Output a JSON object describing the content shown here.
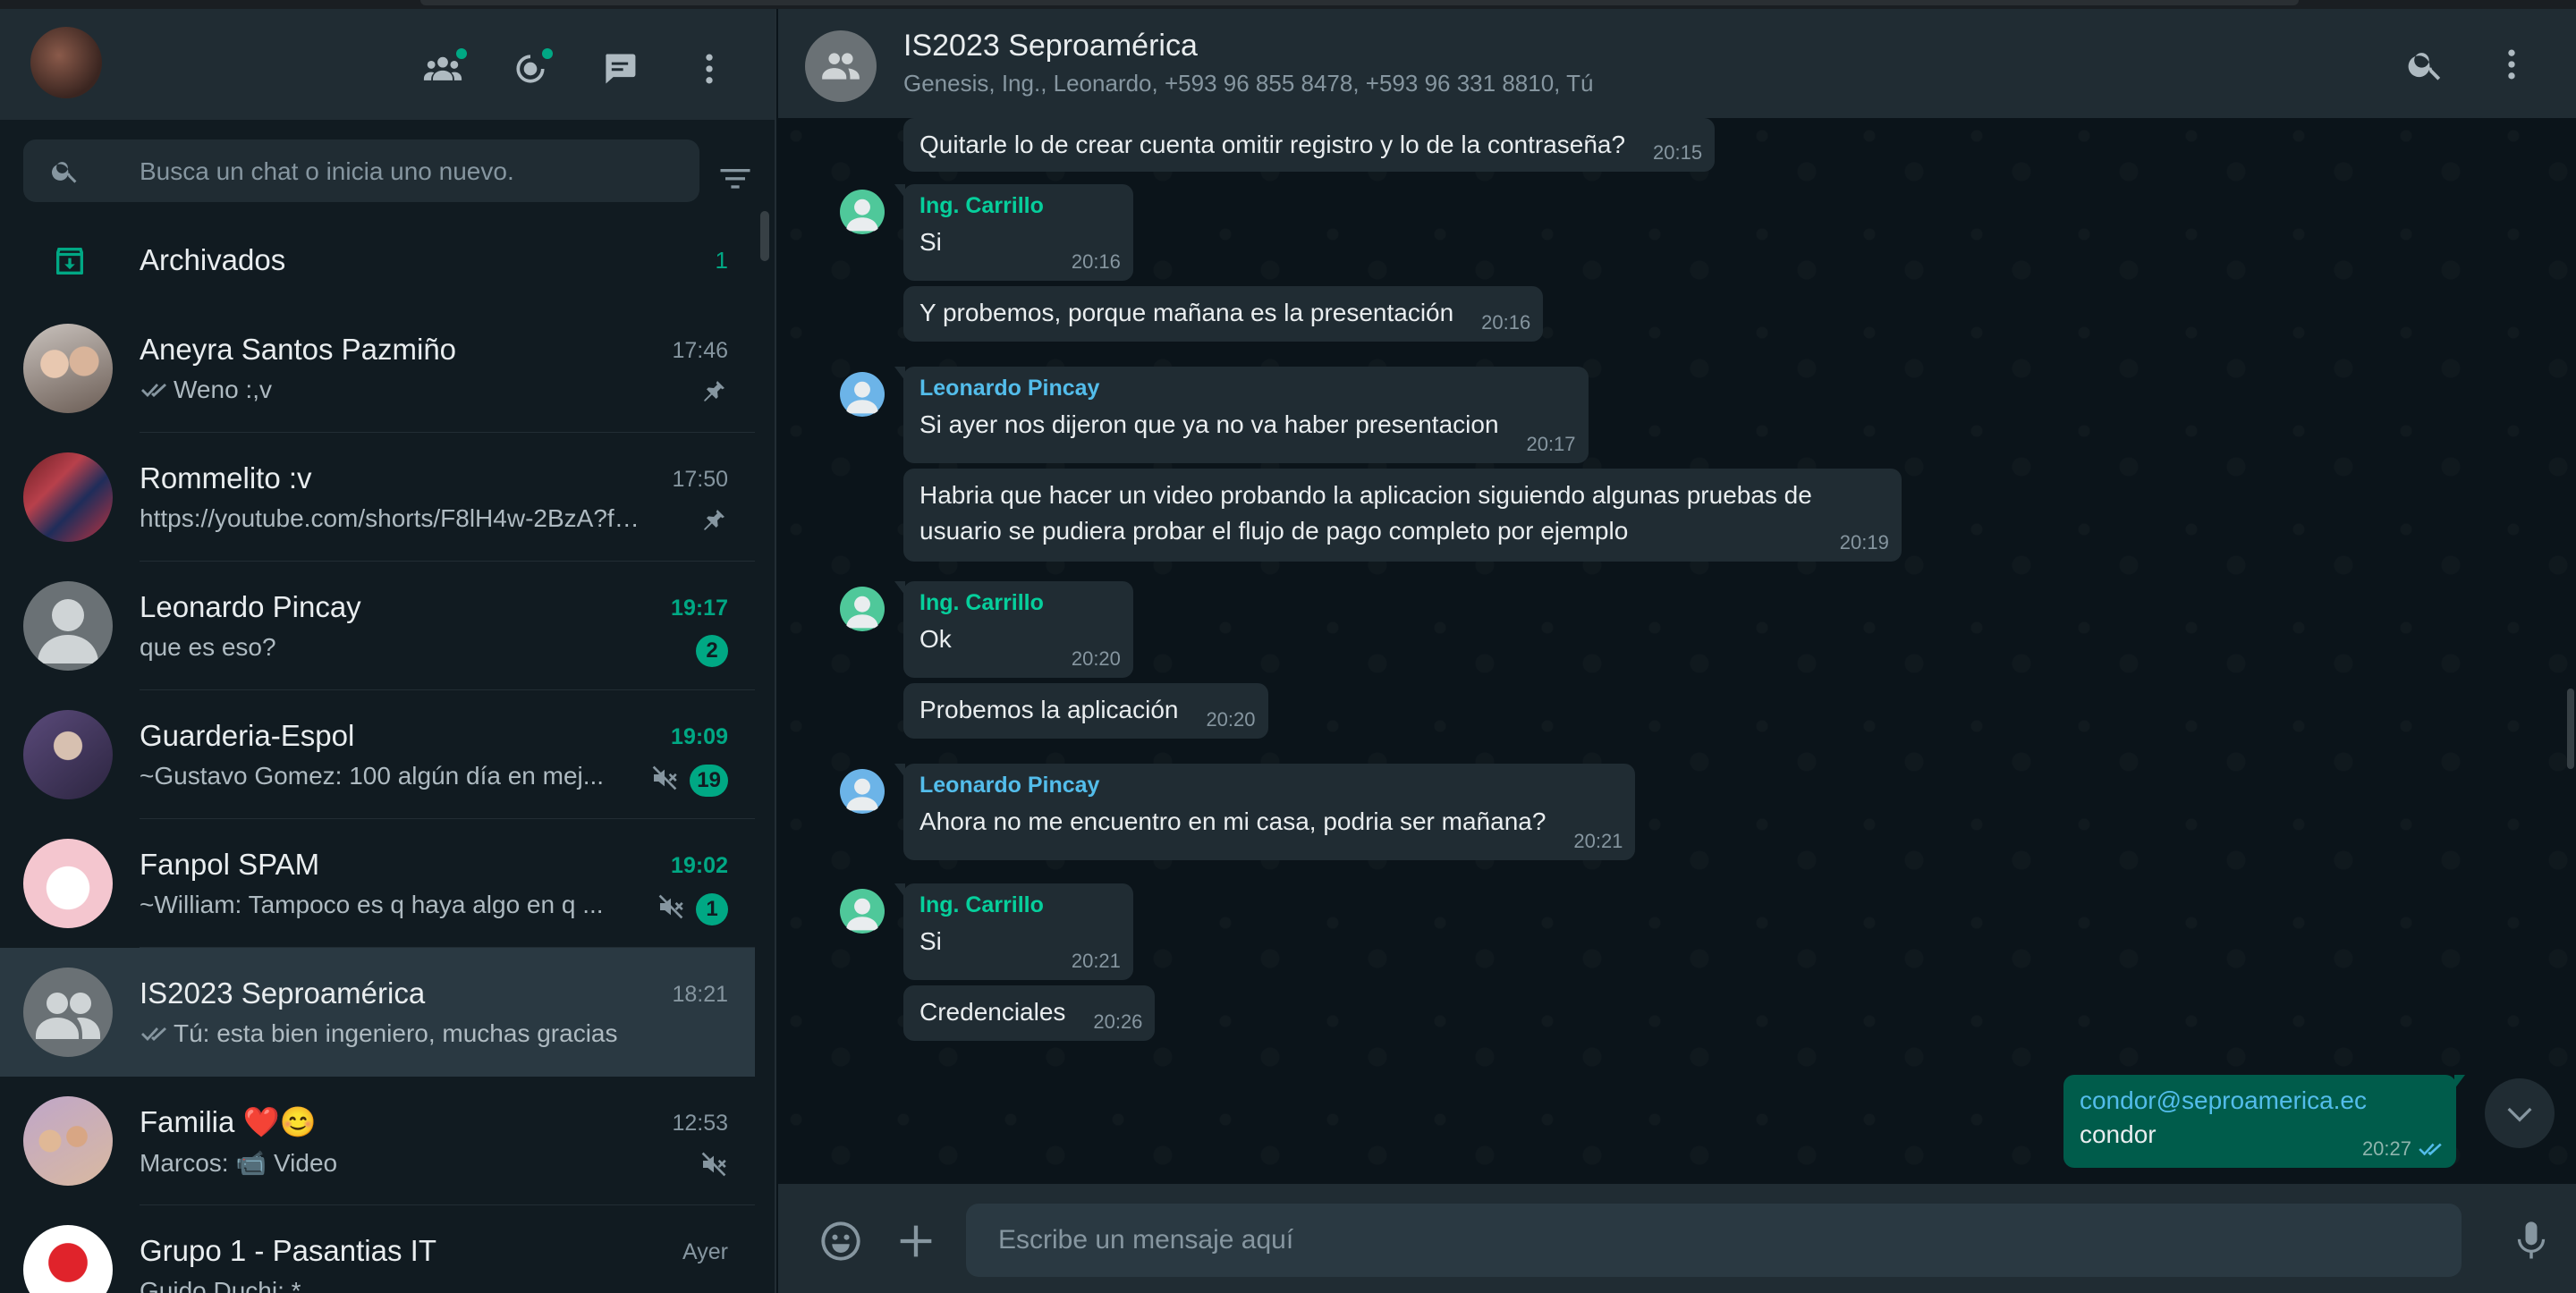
{
  "sidebar": {
    "search_placeholder": "Busca un chat o inicia uno nuevo.",
    "archived": {
      "label": "Archivados",
      "count": "1"
    },
    "chats": [
      {
        "name": "Aneyra Santos Pazmiño",
        "time": "17:46",
        "preview": "Weno :,v",
        "ticks": true,
        "pinned": true,
        "unread_badge": "",
        "muted": false,
        "avatar": "photo-couple",
        "active": false,
        "time_unread": false
      },
      {
        "name": "Rommelito :v",
        "time": "17:50",
        "preview": "https://youtube.com/shorts/F8lH4w-2BzA?fe...",
        "ticks": false,
        "pinned": true,
        "unread_badge": "",
        "muted": false,
        "avatar": "photo-red",
        "active": false,
        "time_unread": false
      },
      {
        "name": "Leonardo Pincay",
        "time": "19:17",
        "preview": "que es eso?",
        "ticks": false,
        "pinned": false,
        "unread_badge": "2",
        "muted": false,
        "avatar": "default-user",
        "active": false,
        "time_unread": true
      },
      {
        "name": "Guarderia-Espol",
        "time": "19:09",
        "preview": "~Gustavo Gomez: 100 algún día en mej...",
        "ticks": false,
        "pinned": false,
        "unread_badge": "19",
        "muted": true,
        "avatar": "photo-purple",
        "active": false,
        "time_unread": true
      },
      {
        "name": "Fanpol SPAM",
        "time": "19:02",
        "preview": "~William: Tampoco es q haya algo en q ...",
        "ticks": false,
        "pinned": false,
        "unread_badge": "1",
        "muted": true,
        "avatar": "photo-goose",
        "active": false,
        "time_unread": true
      },
      {
        "name": "IS2023 Seproamérica",
        "time": "18:21",
        "preview": "Tú: esta bien ingeniero, muchas gracias",
        "ticks": true,
        "pinned": false,
        "unread_badge": "",
        "muted": false,
        "avatar": "default-group",
        "active": true,
        "time_unread": false
      },
      {
        "name": "Familia ❤️😊",
        "time": "12:53",
        "preview": "Marcos: 📹 Video",
        "ticks": false,
        "pinned": false,
        "unread_badge": "",
        "muted": true,
        "avatar": "photo-family",
        "active": false,
        "time_unread": false
      },
      {
        "name": "Grupo 1 - Pasantias IT",
        "time": "Ayer",
        "preview": "Guido Duchi: *",
        "ticks": false,
        "pinned": false,
        "unread_badge": "",
        "muted": false,
        "avatar": "photo-huawei",
        "active": false,
        "time_unread": false
      }
    ]
  },
  "conversation": {
    "title": "IS2023 Seproamérica",
    "subtitle": "Genesis, Ing., Leonardo, +593 96 855 8478, +593 96 331 8810, Tú",
    "composer_placeholder": "Escribe un mensaje aquí",
    "messages": [
      {
        "sender": "",
        "text": "Quitarle lo de crear cuenta omitir registro y lo de la contraseña?",
        "time": "20:15"
      },
      {
        "sender": "Ing. Carrillo",
        "text": "Si",
        "time": "20:16"
      },
      {
        "sender": "",
        "text": "Y probemos, porque mañana es la presentación",
        "time": "20:16"
      },
      {
        "sender": "Leonardo Pincay",
        "text": "Si ayer nos dijeron que ya no va haber presentacion",
        "time": "20:17"
      },
      {
        "sender": "",
        "text": "Habria que hacer un video probando la aplicacion siguiendo algunas pruebas de",
        "text2": "usuario se pudiera probar el flujo de pago completo por ejemplo",
        "time": "20:19"
      },
      {
        "sender": "Ing. Carrillo",
        "text": "Ok",
        "time": "20:20"
      },
      {
        "sender": "",
        "text": "Probemos la aplicación",
        "time": "20:20"
      },
      {
        "sender": "Leonardo Pincay",
        "text": "Ahora no me encuentro en mi casa, podria ser mañana?",
        "time": "20:21"
      },
      {
        "sender": "Ing. Carrillo",
        "text": "Si",
        "time": "20:21"
      },
      {
        "sender": "",
        "text": "Credenciales",
        "time": "20:26"
      },
      {
        "sender": "",
        "text": "condor@seproamerica.ec",
        "text2": "condor",
        "time": "20:27",
        "outgoing": true
      }
    ]
  },
  "colors": {
    "accent": "#00a884",
    "carrillo": "#06cf9c",
    "leonardo": "#53bdeb",
    "bubble_in": "#202c33",
    "bubble_out": "#005c4b"
  }
}
